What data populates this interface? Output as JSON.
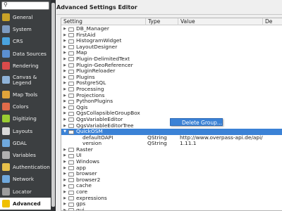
{
  "sidebar": {
    "search": {
      "icon": "search-icon",
      "value": ""
    },
    "items": [
      {
        "label": "General",
        "icon": "wrench-icon",
        "color": "#c9a227"
      },
      {
        "label": "System",
        "icon": "gear-icon",
        "color": "#7d9bc1"
      },
      {
        "label": "CRS",
        "icon": "globe-icon",
        "color": "#4aa3df"
      },
      {
        "label": "Data Sources",
        "icon": "table-icon",
        "color": "#5b8fd1"
      },
      {
        "label": "Rendering",
        "icon": "paint-icon",
        "color": "#d94b4b"
      },
      {
        "label": "Canvas & Legend",
        "icon": "canvas-icon",
        "color": "#8fb3d9"
      },
      {
        "label": "Map Tools",
        "icon": "map-tools-icon",
        "color": "#e0a43a"
      },
      {
        "label": "Colors",
        "icon": "palette-icon",
        "color": "#e06b4a"
      },
      {
        "label": "Digitizing",
        "icon": "digitize-icon",
        "color": "#9acd32"
      },
      {
        "label": "Layouts",
        "icon": "layout-icon",
        "color": "#d9d9d9"
      },
      {
        "label": "GDAL",
        "icon": "gdal-icon",
        "color": "#6fa8dc"
      },
      {
        "label": "Variables",
        "icon": "variables-icon",
        "color": "#b0b0b0"
      },
      {
        "label": "Authentication",
        "icon": "lock-icon",
        "color": "#e6c04a"
      },
      {
        "label": "Network",
        "icon": "network-icon",
        "color": "#6fa8dc"
      },
      {
        "label": "Locator",
        "icon": "locator-icon",
        "color": "#9d9d9d"
      },
      {
        "label": "Advanced",
        "icon": "warning-icon",
        "color": "#f0c000"
      }
    ]
  },
  "main": {
    "title": "Advanced Settings Editor",
    "columns": {
      "setting": "Setting",
      "type": "Type",
      "value": "Value",
      "description": "De"
    },
    "rows": [
      {
        "name": "DB_Manager",
        "type": "",
        "value": "",
        "expanded": false,
        "depth": 0
      },
      {
        "name": "FirstAid",
        "type": "",
        "value": "",
        "expanded": false,
        "depth": 0
      },
      {
        "name": "HistogramWidget",
        "type": "",
        "value": "",
        "expanded": false,
        "depth": 0
      },
      {
        "name": "LayoutDesigner",
        "type": "",
        "value": "",
        "expanded": false,
        "depth": 0
      },
      {
        "name": "Map",
        "type": "",
        "value": "",
        "expanded": false,
        "depth": 0
      },
      {
        "name": "Plugin-DelimitedText",
        "type": "",
        "value": "",
        "expanded": false,
        "depth": 0
      },
      {
        "name": "Plugin-GeoReferencer",
        "type": "",
        "value": "",
        "expanded": false,
        "depth": 0
      },
      {
        "name": "PluginReloader",
        "type": "",
        "value": "",
        "expanded": false,
        "depth": 0
      },
      {
        "name": "Plugins",
        "type": "",
        "value": "",
        "expanded": false,
        "depth": 0
      },
      {
        "name": "PostgreSQL",
        "type": "",
        "value": "",
        "expanded": false,
        "depth": 0
      },
      {
        "name": "Processing",
        "type": "",
        "value": "",
        "expanded": false,
        "depth": 0
      },
      {
        "name": "Projections",
        "type": "",
        "value": "",
        "expanded": false,
        "depth": 0
      },
      {
        "name": "PythonPlugins",
        "type": "",
        "value": "",
        "expanded": false,
        "depth": 0
      },
      {
        "name": "Qgis",
        "type": "",
        "value": "",
        "expanded": false,
        "depth": 0
      },
      {
        "name": "QgsCollapsibleGroupBox",
        "type": "",
        "value": "",
        "expanded": false,
        "depth": 0
      },
      {
        "name": "QgsVariableEditor",
        "type": "",
        "value": "",
        "expanded": false,
        "depth": 0
      },
      {
        "name": "QgsVariableEditorTree",
        "type": "",
        "value": "",
        "expanded": false,
        "depth": 0
      },
      {
        "name": "QuickOSM",
        "type": "",
        "value": "",
        "expanded": true,
        "depth": 0,
        "selected": true
      },
      {
        "name": "defaultOAPI",
        "type": "QString",
        "value": "http://www.overpass-api.de/api/",
        "depth": 1
      },
      {
        "name": "version",
        "type": "QString",
        "value": "1.11.1",
        "depth": 1
      },
      {
        "name": "Raster",
        "type": "",
        "value": "",
        "expanded": false,
        "depth": 0
      },
      {
        "name": "UI",
        "type": "",
        "value": "",
        "expanded": false,
        "depth": 0
      },
      {
        "name": "Windows",
        "type": "",
        "value": "",
        "expanded": false,
        "depth": 0
      },
      {
        "name": "app",
        "type": "",
        "value": "",
        "expanded": false,
        "depth": 0
      },
      {
        "name": "browser",
        "type": "",
        "value": "",
        "expanded": false,
        "depth": 0
      },
      {
        "name": "browser2",
        "type": "",
        "value": "",
        "expanded": false,
        "depth": 0
      },
      {
        "name": "cache",
        "type": "",
        "value": "",
        "expanded": false,
        "depth": 0
      },
      {
        "name": "core",
        "type": "",
        "value": "",
        "expanded": false,
        "depth": 0
      },
      {
        "name": "expressions",
        "type": "",
        "value": "",
        "expanded": false,
        "depth": 0
      },
      {
        "name": "gps",
        "type": "",
        "value": "",
        "expanded": false,
        "depth": 0
      },
      {
        "name": "gui",
        "type": "",
        "value": "",
        "expanded": false,
        "depth": 0
      }
    ],
    "context_menu": {
      "items": [
        {
          "label": "Delete Group..."
        }
      ]
    }
  },
  "colors": {
    "selection": "#3b82d6",
    "sidebar_bg": "#3c3f41"
  }
}
